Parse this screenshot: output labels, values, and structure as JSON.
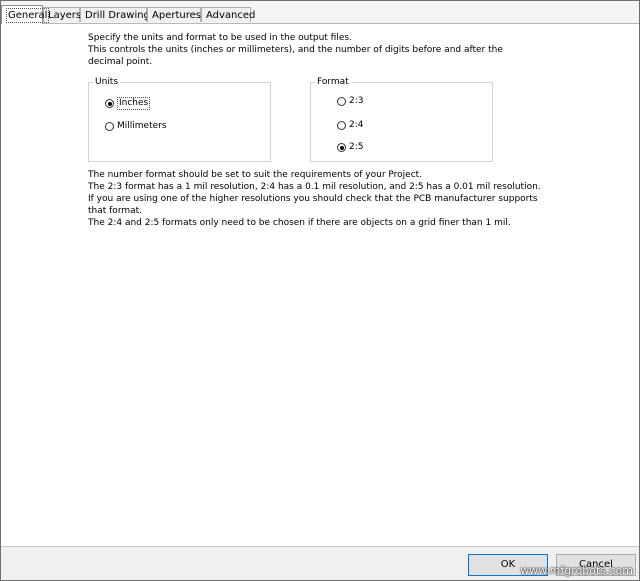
{
  "tabs": [
    {
      "label": "General",
      "active": true
    },
    {
      "label": "Layers",
      "active": false
    },
    {
      "label": "Drill Drawing",
      "active": false
    },
    {
      "label": "Apertures",
      "active": false
    },
    {
      "label": "Advanced",
      "active": false
    }
  ],
  "intro": {
    "line1": "Specify the units and format to be used in the output files.",
    "line2": "This controls the units (inches or millimeters), and the number of digits before and after the",
    "line3": "decimal point."
  },
  "units_group": {
    "title": "Units",
    "options": [
      {
        "label": "Inches",
        "checked": true
      },
      {
        "label": "Millimeters",
        "checked": false
      }
    ]
  },
  "format_group": {
    "title": "Format",
    "options": [
      {
        "label": "2:3",
        "checked": false
      },
      {
        "label": "2:4",
        "checked": false
      },
      {
        "label": "2:5",
        "checked": true
      }
    ]
  },
  "info": {
    "line1": "The number format should be set to suit the requirements of your Project.",
    "line2": "The 2:3 format has a 1 mil resolution, 2:4 has a 0.1 mil resolution, and 2:5 has a 0.01 mil resolution.",
    "line3": "If you are using one of the higher resolutions you should check that the PCB manufacturer supports",
    "line4": "that format.",
    "line5": "The 2:4 and 2:5 formats only need to be chosen if there are objects on a grid finer than 1 mil."
  },
  "buttons": {
    "ok": "OK",
    "cancel": "Cancel"
  },
  "watermark": "www.mfgrobots.com",
  "colors": {
    "accent": "#0078d7",
    "footer_bg": "#f0f0f0"
  }
}
